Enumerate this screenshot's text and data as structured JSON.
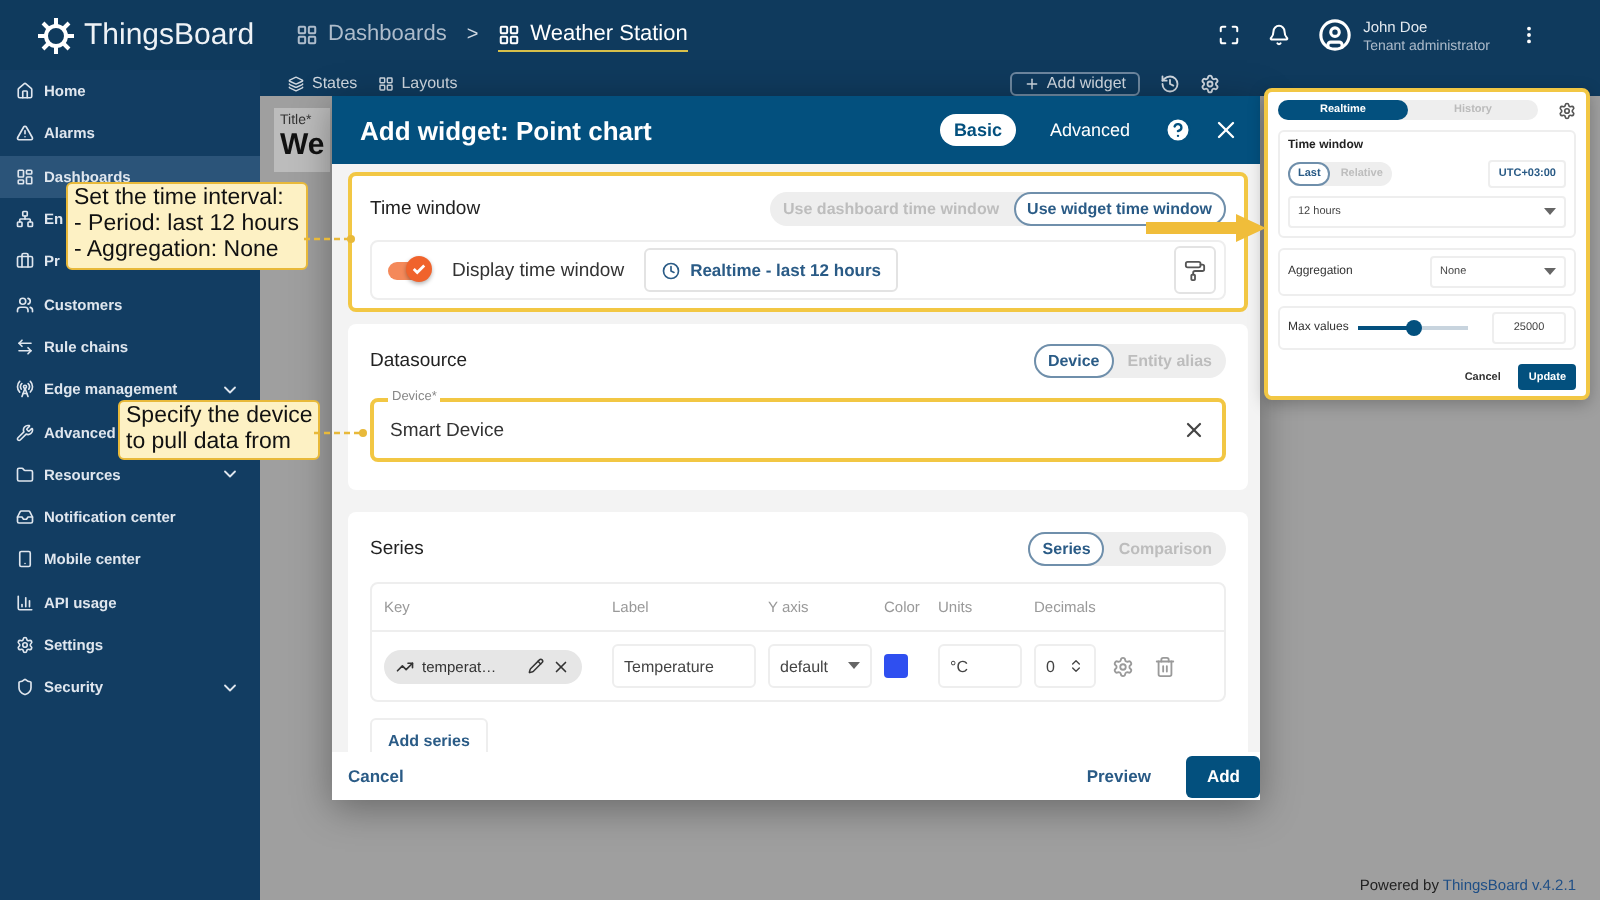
{
  "header": {
    "brand": "ThingsBoard",
    "breadcrumbs": [
      {
        "label": "Dashboards",
        "selected": false
      },
      {
        "label": "Weather Station",
        "selected": true
      }
    ],
    "separator": ">",
    "user": {
      "name": "John Doe",
      "role": "Tenant administrator"
    }
  },
  "sidebar": {
    "items": [
      {
        "label": "Home",
        "expandable": false,
        "selected": false
      },
      {
        "label": "Alarms",
        "expandable": false,
        "selected": false
      },
      {
        "label": "Dashboards",
        "expandable": false,
        "selected": true
      },
      {
        "label": "En",
        "expandable": false,
        "selected": false
      },
      {
        "label": "Pr",
        "expandable": false,
        "selected": false
      },
      {
        "label": "Customers",
        "expandable": false,
        "selected": false
      },
      {
        "label": "Rule chains",
        "expandable": false,
        "selected": false
      },
      {
        "label": "Edge management",
        "expandable": true,
        "selected": false
      },
      {
        "label": "Advanced",
        "expandable": false,
        "selected": false
      },
      {
        "label": "Resources",
        "expandable": true,
        "selected": false
      },
      {
        "label": "Notification center",
        "expandable": false,
        "selected": false
      },
      {
        "label": "Mobile center",
        "expandable": false,
        "selected": false
      },
      {
        "label": "API usage",
        "expandable": false,
        "selected": false
      },
      {
        "label": "Settings",
        "expandable": false,
        "selected": false
      },
      {
        "label": "Security",
        "expandable": true,
        "selected": false
      }
    ]
  },
  "dashboard": {
    "toolbar": {
      "states": "States",
      "layouts": "Layouts",
      "add_widget": "Add widget"
    },
    "title_label": "Title*",
    "title_value": "We"
  },
  "dialog": {
    "title": "Add widget: Point chart",
    "modes": [
      {
        "label": "Basic",
        "selected": true
      },
      {
        "label": "Advanced",
        "selected": false
      }
    ],
    "time_window": {
      "heading": "Time window",
      "highlighted": true,
      "options": [
        {
          "label": "Use dashboard time window",
          "selected": false
        },
        {
          "label": "Use widget time window",
          "selected": true
        }
      ],
      "display": {
        "label": "Display time window",
        "on": true
      },
      "interval": "Realtime - last 12 hours"
    },
    "datasource": {
      "heading": "Datasource",
      "highlighted": false,
      "options": [
        {
          "label": "Device",
          "selected": true
        },
        {
          "label": "Entity alias",
          "selected": false
        }
      ],
      "field": {
        "label": "Device*",
        "value": "Smart Device",
        "highlighted": true
      }
    },
    "series": {
      "heading": "Series",
      "options": [
        {
          "label": "Series",
          "selected": true
        },
        {
          "label": "Comparison",
          "selected": false
        }
      ],
      "columns": [
        "Key",
        "Label",
        "Y axis",
        "Color",
        "Units",
        "Decimals"
      ],
      "rows": [
        {
          "key": "temperat…",
          "label": "Temperature",
          "y_axis": "default",
          "color": "#2f4ff0",
          "units": "°C",
          "decimals": "0"
        }
      ],
      "add": "Add series"
    },
    "actions": {
      "cancel": "Cancel",
      "preview": "Preview",
      "add": "Add"
    }
  },
  "timewindow_popup": {
    "tabs": [
      {
        "label": "Realtime",
        "selected": true
      },
      {
        "label": "History",
        "selected": false
      }
    ],
    "heading": "Time window",
    "modes": [
      {
        "label": "Last",
        "selected": true
      },
      {
        "label": "Relative",
        "selected": false
      }
    ],
    "timezone": "UTC+03:00",
    "interval": "12 hours",
    "aggregation": {
      "label": "Aggregation",
      "value": "None"
    },
    "max_values": {
      "label": "Max values",
      "level": 0.5,
      "value": "25000"
    },
    "cancel": "Cancel",
    "update": "Update"
  },
  "callouts": [
    {
      "text": "Set the time interval:\n- Period: last 12 hours\n- Aggregation:  None"
    },
    {
      "text": "Specify the device\nto pull data from"
    }
  ],
  "footer": {
    "prefix": "Powered by",
    "link": "ThingsBoard v.4.2.1"
  }
}
